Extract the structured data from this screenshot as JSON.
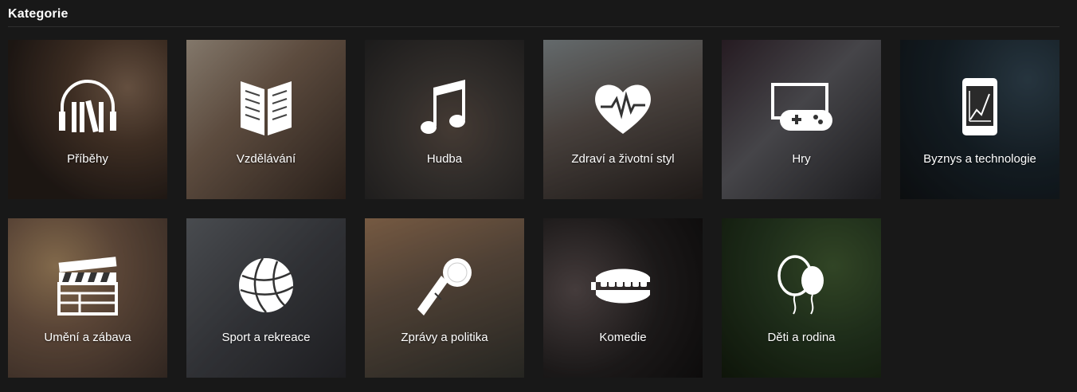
{
  "header": {
    "title": "Kategorie"
  },
  "categories": [
    {
      "label": "Příběhy",
      "icon": "headphones-books-icon"
    },
    {
      "label": "Vzdělávání",
      "icon": "open-book-icon"
    },
    {
      "label": "Hudba",
      "icon": "music-note-icon"
    },
    {
      "label": "Zdraví a životní styl",
      "icon": "heart-pulse-icon"
    },
    {
      "label": "Hry",
      "icon": "monitor-gamepad-icon"
    },
    {
      "label": "Byznys a technologie",
      "icon": "phone-chart-icon"
    },
    {
      "label": "Umění a zábava",
      "icon": "clapperboard-icon"
    },
    {
      "label": "Sport a rekreace",
      "icon": "basketball-icon"
    },
    {
      "label": "Zprávy a politika",
      "icon": "microphone-icon"
    },
    {
      "label": "Komedie",
      "icon": "chattering-teeth-icon"
    },
    {
      "label": "Děti a rodina",
      "icon": "balloons-icon"
    }
  ]
}
